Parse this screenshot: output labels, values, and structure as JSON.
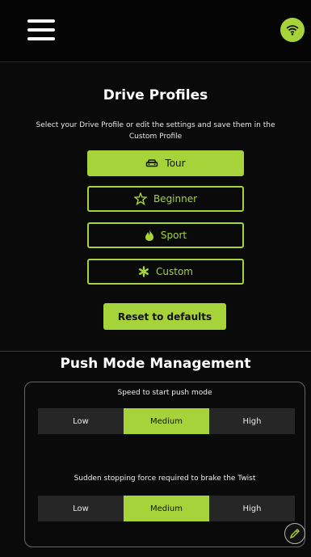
{
  "header": {
    "menu_icon": "hamburger-menu-icon",
    "wifi_icon": "wifi-icon"
  },
  "drive_profiles": {
    "title": "Drive Profiles",
    "subtitle": "Select your Drive Profile or edit the settings and save them in the Custom Profile",
    "profiles": [
      {
        "label": "Tour",
        "icon": "car-icon",
        "active": true
      },
      {
        "label": "Beginner",
        "icon": "star-figure-icon",
        "active": false
      },
      {
        "label": "Sport",
        "icon": "flame-icon",
        "active": false
      },
      {
        "label": "Custom",
        "icon": "asterisk-icon",
        "active": false
      }
    ],
    "reset_label": "Reset to defaults"
  },
  "push_mode": {
    "title": "Push Mode Management",
    "speed_caption": "Speed to start push mode",
    "speed_options": [
      "Low",
      "Medium",
      "High"
    ],
    "speed_selected": "Medium",
    "brake_caption": "Sudden stopping force required to brake the Twist",
    "brake_options": [
      "Low",
      "Medium",
      "High"
    ],
    "brake_selected": "Medium"
  },
  "edit_icon": "pencil-icon",
  "colors": {
    "accent": "#a6d23a",
    "background": "#0a0a0a",
    "segment_bg": "#262626"
  }
}
